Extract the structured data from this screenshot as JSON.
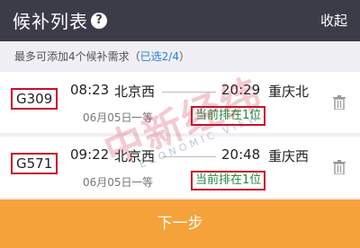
{
  "header": {
    "title": "候补列表",
    "help_icon": "?",
    "collapse_label": "收起"
  },
  "notice": {
    "text": "最多可添加4个候补需求（",
    "selected": "已选2/4",
    "close_paren": "）"
  },
  "trains": [
    {
      "number": "G309",
      "dep_time": "08:23",
      "dep_station": "北京西",
      "arr_time": "20:29",
      "arr_station": "重庆北",
      "date": "06月05日",
      "seat": "一等",
      "rank": "当前排在1位"
    },
    {
      "number": "G571",
      "dep_time": "09:22",
      "dep_station": "北京西",
      "arr_time": "20:48",
      "arr_station": "重庆西",
      "date": "06月05日",
      "seat": "一等",
      "rank": "当前排在1位"
    }
  ],
  "watermark": {
    "text": "中新经纬",
    "subtext": "ECONOMIC VIEW"
  },
  "footer": {
    "next_label": "下一步"
  },
  "colors": {
    "header_bg": "#3c3c48",
    "accent_orange": "#f5a23a",
    "highlight_red": "#c8102e",
    "rank_green": "#1f8a3b",
    "link_blue": "#2a7de1"
  }
}
